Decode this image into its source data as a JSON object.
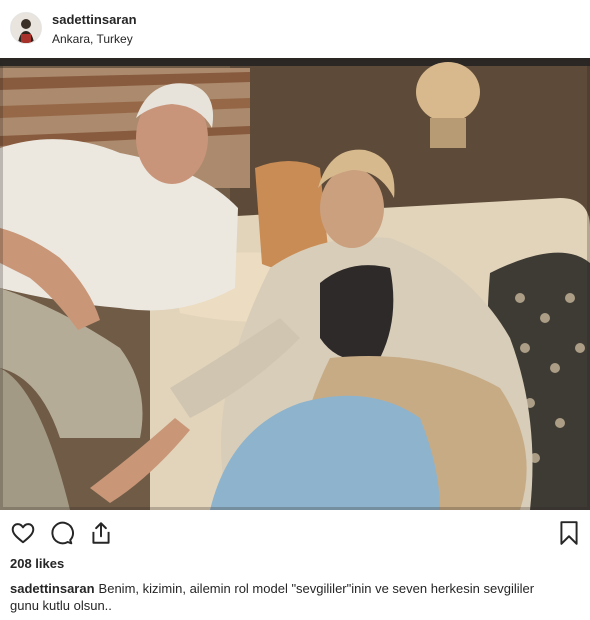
{
  "post": {
    "username": "sadettinsaran",
    "location": "Ankara, Turkey",
    "likes": "208 likes",
    "caption_user": "sadettinsaran",
    "caption_line1": "Benim, kizimin, ailemin rol model \"sevgililer\"inin ve seven herkesin sevgililer",
    "caption_line2": "gunu kutlu olsun.."
  },
  "icons": {
    "like": "heart-outline-icon",
    "comment": "speech-bubble-icon",
    "share": "share-upload-icon",
    "bookmark": "bookmark-icon"
  },
  "colors": {
    "text": "#262626",
    "muted": "#8e8e8e"
  }
}
